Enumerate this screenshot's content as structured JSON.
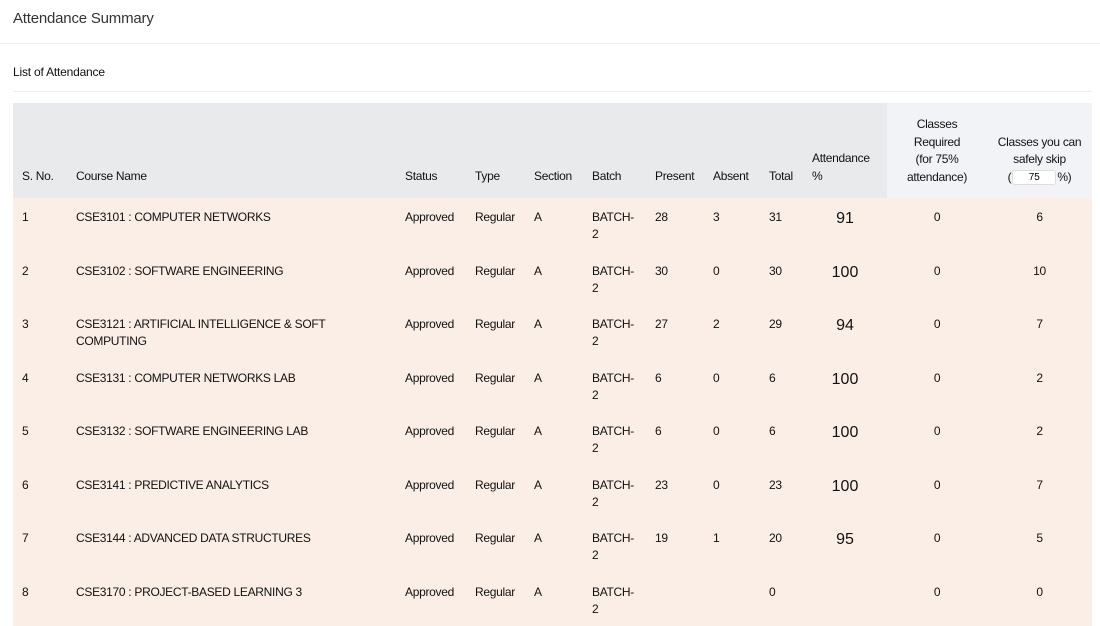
{
  "page": {
    "title": "Attendance Summary"
  },
  "section": {
    "title": "List of Attendance"
  },
  "columns": {
    "sno": "S. No.",
    "course": "Course Name",
    "status": "Status",
    "type": "Type",
    "section": "Section",
    "batch": "Batch",
    "present": "Present",
    "absent": "Absent",
    "total": "Total",
    "attendance_l1": "Attendance",
    "attendance_l2": "%",
    "required_l1": "Classes",
    "required_l2": "Required",
    "required_l3": "(for 75%",
    "required_l4": "attendance)",
    "skip_l1": "Classes you can",
    "skip_l2": "safely skip",
    "skip_open": "(",
    "skip_close": "%)"
  },
  "skip_percent": "75",
  "rows": [
    {
      "sno": "1",
      "course": "CSE3101 : COMPUTER NETWORKS",
      "status": "Approved",
      "type": "Regular",
      "section": "A",
      "batch_l1": "BATCH-",
      "batch_l2": "2",
      "present": "28",
      "absent": "3",
      "total": "31",
      "pct": "91",
      "required": "0",
      "skip": "6"
    },
    {
      "sno": "2",
      "course": "CSE3102 : SOFTWARE ENGINEERING",
      "status": "Approved",
      "type": "Regular",
      "section": "A",
      "batch_l1": "BATCH-",
      "batch_l2": "2",
      "present": "30",
      "absent": "0",
      "total": "30",
      "pct": "100",
      "required": "0",
      "skip": "10"
    },
    {
      "sno": "3",
      "course": "CSE3121 : ARTIFICIAL INTELLIGENCE & SOFT COMPUTING",
      "status": "Approved",
      "type": "Regular",
      "section": "A",
      "batch_l1": "BATCH-",
      "batch_l2": "2",
      "present": "27",
      "absent": "2",
      "total": "29",
      "pct": "94",
      "required": "0",
      "skip": "7"
    },
    {
      "sno": "4",
      "course": "CSE3131 : COMPUTER NETWORKS LAB",
      "status": "Approved",
      "type": "Regular",
      "section": "A",
      "batch_l1": "BATCH-",
      "batch_l2": "2",
      "present": "6",
      "absent": "0",
      "total": "6",
      "pct": "100",
      "required": "0",
      "skip": "2"
    },
    {
      "sno": "5",
      "course": "CSE3132 : SOFTWARE ENGINEERING LAB",
      "status": "Approved",
      "type": "Regular",
      "section": "A",
      "batch_l1": "BATCH-",
      "batch_l2": "2",
      "present": "6",
      "absent": "0",
      "total": "6",
      "pct": "100",
      "required": "0",
      "skip": "2"
    },
    {
      "sno": "6",
      "course": "CSE3141 : PREDICTIVE ANALYTICS",
      "status": "Approved",
      "type": "Regular",
      "section": "A",
      "batch_l1": "BATCH-",
      "batch_l2": "2",
      "present": "23",
      "absent": "0",
      "total": "23",
      "pct": "100",
      "required": "0",
      "skip": "7"
    },
    {
      "sno": "7",
      "course": "CSE3144 : ADVANCED DATA STRUCTURES",
      "status": "Approved",
      "type": "Regular",
      "section": "A",
      "batch_l1": "BATCH-",
      "batch_l2": "2",
      "present": "19",
      "absent": "1",
      "total": "20",
      "pct": "95",
      "required": "0",
      "skip": "5"
    },
    {
      "sno": "8",
      "course": "CSE3170 : PROJECT-BASED LEARNING 3",
      "status": "Approved",
      "type": "Regular",
      "section": "A",
      "batch_l1": "BATCH-",
      "batch_l2": "2",
      "present": "",
      "absent": "",
      "total": "0",
      "pct": "",
      "required": "0",
      "skip": "0"
    }
  ]
}
